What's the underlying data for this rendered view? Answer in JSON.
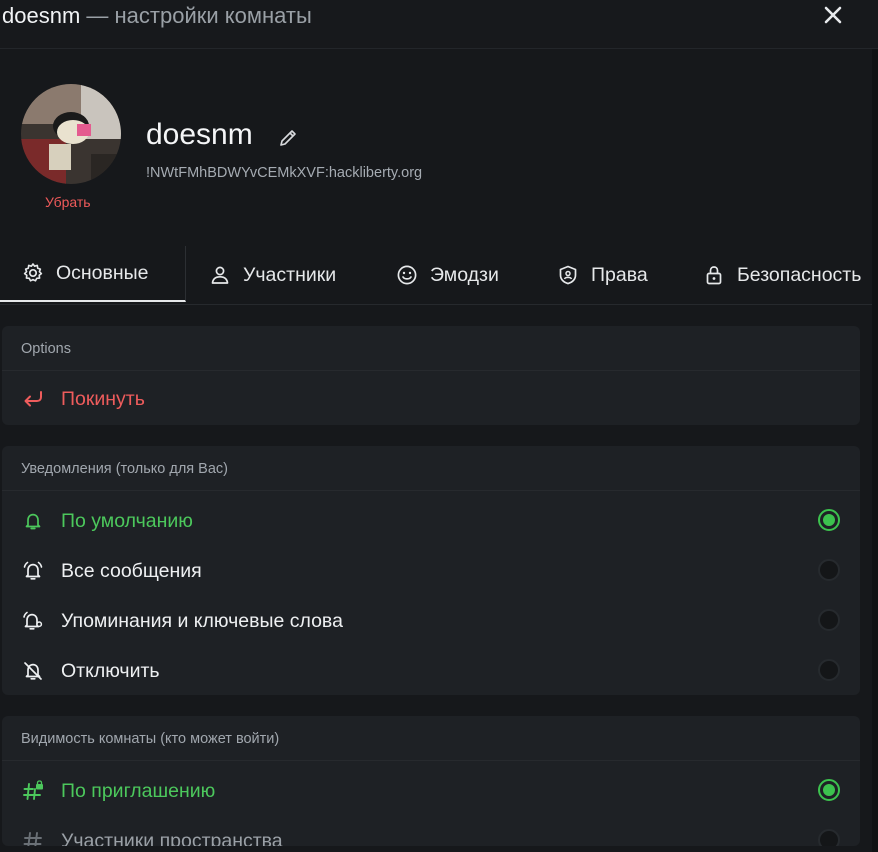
{
  "window": {
    "room_name": "doesnm",
    "title_suffix": " — настройки комнаты",
    "close_icon": "close-icon"
  },
  "profile": {
    "name": "doesnm",
    "room_id": "!NWtFMhBDWYvCEMkXVF:hackliberty.org",
    "remove_label": "Убрать",
    "avatar_icon": "avatar-photo"
  },
  "tabs": [
    {
      "label": "Основные",
      "icon": "gear-icon",
      "active": true
    },
    {
      "label": "Участники",
      "icon": "user-icon",
      "active": false
    },
    {
      "label": "Эмодзи",
      "icon": "smile-icon",
      "active": false
    },
    {
      "label": "Права",
      "icon": "shield-icon",
      "active": false
    },
    {
      "label": "Безопасность",
      "icon": "lock-icon",
      "active": false
    }
  ],
  "options": {
    "heading": "Options",
    "leave_label": "Покинуть",
    "leave_icon": "leave-arrow-icon"
  },
  "notifications": {
    "heading": "Уведомления (только для Вас)",
    "items": [
      {
        "label": "По умолчанию",
        "icon": "bell-icon",
        "selected": true
      },
      {
        "label": "Все сообщения",
        "icon": "bell-ring-icon",
        "selected": false
      },
      {
        "label": "Упоминания и ключевые слова",
        "icon": "bell-mention-icon",
        "selected": false
      },
      {
        "label": "Отключить",
        "icon": "bell-off-icon",
        "selected": false
      }
    ]
  },
  "visibility": {
    "heading": "Видимость комнаты (кто может войти)",
    "items": [
      {
        "label": "По приглашению",
        "icon": "hash-lock-icon",
        "selected": true
      },
      {
        "label": "Участники пространства",
        "icon": "hash-icon",
        "selected": false
      }
    ]
  },
  "colors": {
    "accent_green": "#3cc24e",
    "danger_red": "#ee5c5c",
    "background": "#16181b",
    "card": "#1e2125"
  }
}
